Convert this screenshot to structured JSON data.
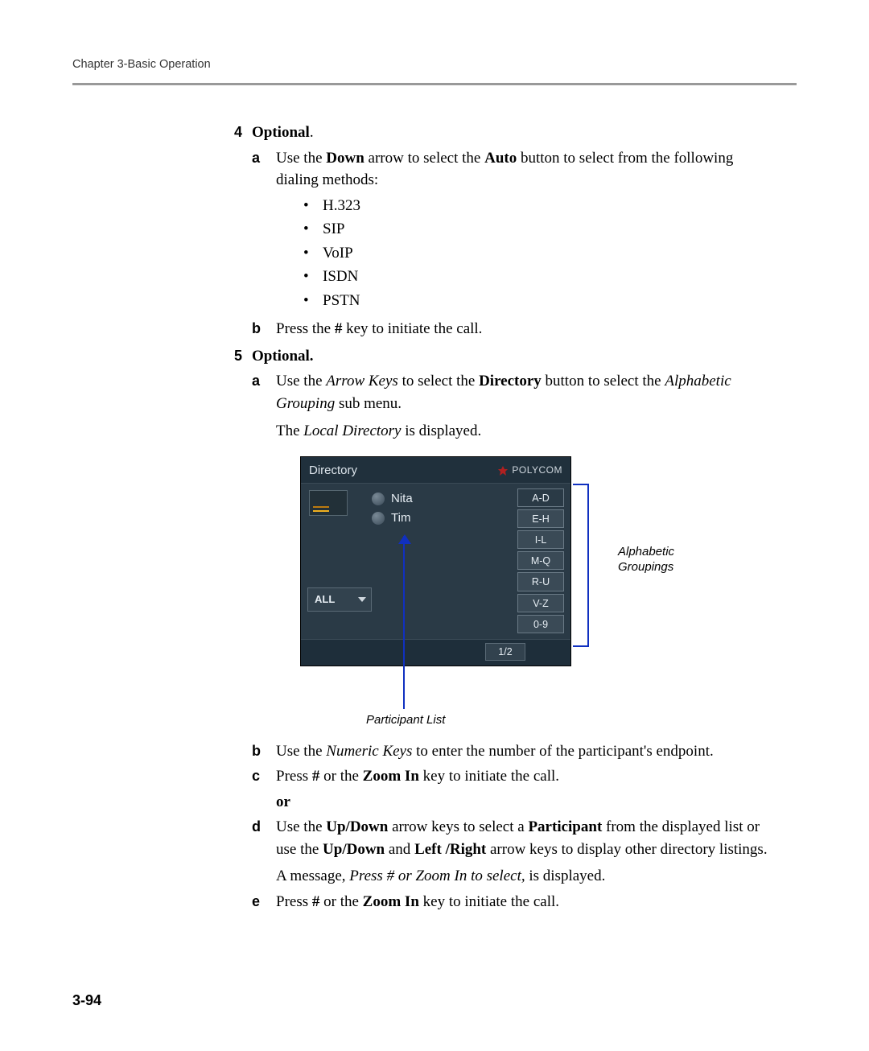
{
  "header": {
    "running": "Chapter 3-Basic Operation"
  },
  "footer": {
    "page": "3-94"
  },
  "steps": {
    "s4": {
      "num": "4",
      "lead": "Optional",
      "tail": ".",
      "a": {
        "letter": "a",
        "pre": "Use the ",
        "kw1": "Down",
        "mid": " arrow to select the ",
        "kw2": "Auto",
        "post": " button to select from the following dialing methods:",
        "bullets": [
          "H.323",
          "SIP",
          "VoIP",
          "ISDN",
          "PSTN"
        ]
      },
      "b": {
        "letter": "b",
        "pre": "Press the ",
        "kw1": "#",
        "post": " key to initiate the call."
      }
    },
    "s5": {
      "num": "5",
      "lead": "Optional.",
      "a": {
        "letter": "a",
        "pre": "Use the ",
        "it1": "Arrow Keys",
        "mid1": " to select the ",
        "kw1": "Directory",
        "mid2": " button to select the ",
        "it2": "Alphabetic Grouping",
        "post1": " sub menu.",
        "line2_pre": "The ",
        "line2_it": "Local Directory",
        "line2_post": " is displayed."
      },
      "b": {
        "letter": "b",
        "pre": "Use the ",
        "it1": "Numeric Keys",
        "post": " to enter the number of the participant's endpoint."
      },
      "c": {
        "letter": "c",
        "pre": "Press ",
        "kw1": "#",
        "mid": " or the ",
        "kw2": "Zoom In",
        "post": " key to initiate the call.",
        "or": "or"
      },
      "d": {
        "letter": "d",
        "pre": "Use the ",
        "kw1": "Up/Down",
        "mid1": " arrow keys to select a ",
        "kw2": "Participant",
        "mid2": " from the displayed list or use the ",
        "kw3": "Up/Down",
        "mid3": " and ",
        "kw4": "Left /Right",
        "post1": " arrow keys to display other directory listings.",
        "line2_pre": "A message, ",
        "line2_it": "Press # or Zoom In to select,",
        "line2_post": " is displayed."
      },
      "e": {
        "letter": "e",
        "pre": "Press ",
        "kw1": "#",
        "mid": " or  the ",
        "kw2": "Zoom In",
        "post": " key to initiate the call."
      }
    }
  },
  "device": {
    "title": "Directory",
    "brand": "POLYCOM",
    "participants": [
      "Nita",
      "Tim"
    ],
    "all_label": "ALL",
    "groups": [
      "A-D",
      "E-H",
      "I-L",
      "M-Q",
      "R-U",
      "V-Z",
      "0-9"
    ],
    "page_indicator": "1/2"
  },
  "annotations": {
    "right1": "Alphabetic",
    "right2": "Groupings",
    "below": "Participant List"
  }
}
